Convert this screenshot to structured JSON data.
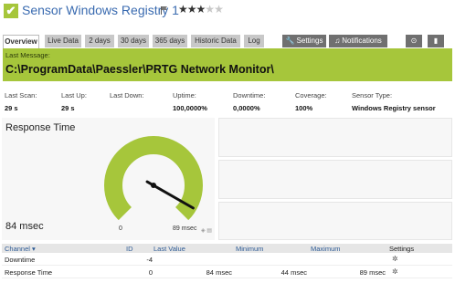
{
  "header": {
    "title": "Sensor Windows Registry 1",
    "status_icon": "check-icon",
    "priority_stars_filled": 3,
    "priority_stars_total": 5
  },
  "tabs": [
    {
      "label": "Overview",
      "active": true
    },
    {
      "label": "Live Data"
    },
    {
      "label": "2 days"
    },
    {
      "label": "30 days"
    },
    {
      "label": "365 days"
    },
    {
      "label": "Historic Data"
    },
    {
      "label": "Log"
    },
    {
      "label": "Settings",
      "icon": "wrench-icon"
    },
    {
      "label": "Notifications",
      "icon": "bell-icon"
    }
  ],
  "message": {
    "label": "Last Message:",
    "text": "C:\\ProgramData\\Paessler\\PRTG Network Monitor\\"
  },
  "stats": [
    {
      "label": "Last Scan:",
      "value": "29 s"
    },
    {
      "label": "Last Up:",
      "value": "29 s"
    },
    {
      "label": "Last Down:",
      "value": ""
    },
    {
      "label": "Uptime:",
      "value": "100,0000%"
    },
    {
      "label": "Downtime:",
      "value": "0,0000%"
    },
    {
      "label": "Coverage:",
      "value": "100%"
    },
    {
      "label": "Sensor Type:",
      "value": "Windows Registry sensor"
    }
  ],
  "gauge": {
    "title": "Response Time",
    "reading": "84 msec",
    "min_label": "0",
    "max_label": "89 msec",
    "value": 84,
    "max": 89,
    "color": "#a6c63b"
  },
  "table": {
    "headers": {
      "channel": "Channel",
      "id": "ID",
      "last_value": "Last Value",
      "minimum": "Minimum",
      "maximum": "Maximum",
      "settings": "Settings"
    },
    "rows": [
      {
        "channel": "Downtime",
        "id": "-4",
        "last_value": "",
        "minimum": "",
        "maximum": ""
      },
      {
        "channel": "Response Time",
        "id": "0",
        "last_value": "84 msec",
        "minimum": "44 msec",
        "maximum": "89 msec"
      }
    ]
  },
  "colors": {
    "accent_green": "#a6c63b",
    "title_blue": "#3a6bb0"
  }
}
